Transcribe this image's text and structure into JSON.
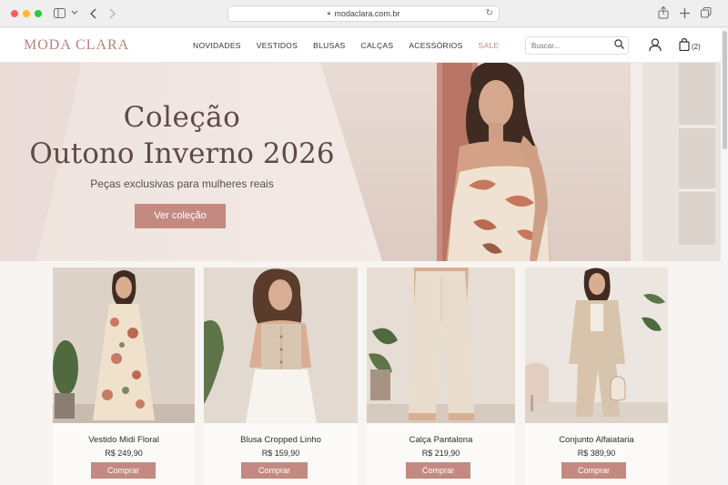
{
  "browser": {
    "url": "modaclara.com.br"
  },
  "header": {
    "logo": "MODA CLARA",
    "nav": [
      "NOVIDADES",
      "VESTIDOS",
      "BLUSAS",
      "CALÇAS",
      "ACESSÓRIOS",
      "SALE"
    ],
    "search_placeholder": "Buscar...",
    "cart_count": "(2)"
  },
  "hero": {
    "title_line1": "Coleção",
    "title_line2": "Outono Inverno 2026",
    "subtitle": "Peças exclusivas para mulheres reais",
    "cta": "Ver coleção"
  },
  "products": [
    {
      "name": "Vestido Midi Floral",
      "price": "R$ 249,90",
      "button": "Comprar"
    },
    {
      "name": "Blusa Cropped Linho",
      "price": "R$ 159,90",
      "button": "Comprar"
    },
    {
      "name": "Calça Pantalona",
      "price": "R$ 219,90",
      "button": "Comprar"
    },
    {
      "name": "Conjunto Alfaiataria",
      "price": "R$ 389,90",
      "button": "Comprar"
    }
  ],
  "colors": {
    "accent": "#c48a82",
    "logo": "#b4837a",
    "hero_text": "#5e4a46"
  }
}
